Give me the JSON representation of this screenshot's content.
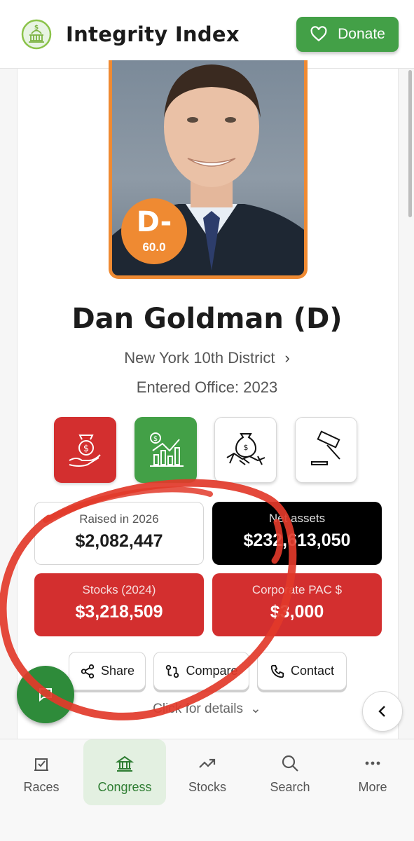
{
  "header": {
    "app_title": "Integrity Index",
    "donate_label": "Donate",
    "logo_icon": "capitol-dollar-logo-icon"
  },
  "profile": {
    "grade": "D-",
    "score": "60.0",
    "name": "Dan Goldman (D)",
    "district": "New York 10th District",
    "entered_office": "Entered Office: 2023",
    "grade_color": "#ef8a32"
  },
  "categories": [
    {
      "icon": "money-bag-hand-icon",
      "state": "red"
    },
    {
      "icon": "stock-chart-icon",
      "state": "green"
    },
    {
      "icon": "handshake-money-icon",
      "state": "neutral"
    },
    {
      "icon": "gavel-icon",
      "state": "neutral"
    }
  ],
  "stats": {
    "raised": {
      "label": "Raised in 2026",
      "value": "$2,082,447"
    },
    "net_assets": {
      "label": "Net assets",
      "value": "$232,613,050"
    },
    "stocks": {
      "label": "Stocks (2024)",
      "value": "$3,218,509"
    },
    "corporate_pac": {
      "label": "Corporate PAC $",
      "value": "$3,000"
    }
  },
  "actions": {
    "share": "Share",
    "compare": "Compare",
    "contact": "Contact"
  },
  "details_label": "Click for details",
  "nav": [
    {
      "label": "Races",
      "icon": "ballot-box-icon"
    },
    {
      "label": "Congress",
      "icon": "capitol-building-icon",
      "active": true
    },
    {
      "label": "Stocks",
      "icon": "trending-up-icon"
    },
    {
      "label": "Search",
      "icon": "search-icon"
    },
    {
      "label": "More",
      "icon": "more-dots-icon"
    }
  ],
  "colors": {
    "brand_green": "#43a047",
    "red": "#d32f2f",
    "orange": "#ef8a32",
    "annotation_red": "#e23a2a"
  }
}
